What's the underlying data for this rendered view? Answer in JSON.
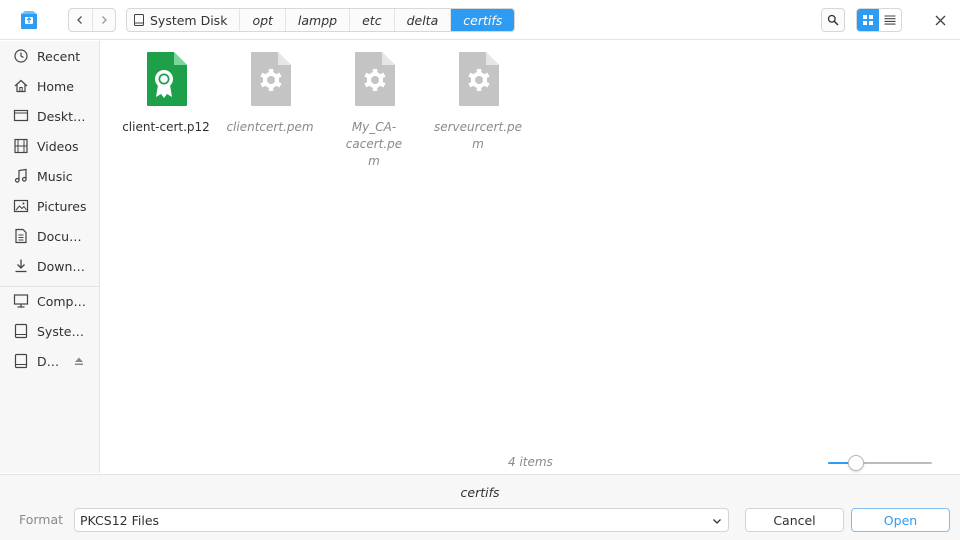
{
  "colors": {
    "accent": "#2d9cf2",
    "cert_green": "#1ea04a",
    "generic_file_gray": "#bdbdbd"
  },
  "titlebar": {
    "app_icon": "file-manager-icon",
    "back_icon": "chevron-left-icon",
    "forward_icon": "chevron-right-icon",
    "breadcrumbs": [
      {
        "label": "System Disk",
        "icon": "disk-icon"
      },
      {
        "label": "opt"
      },
      {
        "label": "lampp"
      },
      {
        "label": "etc"
      },
      {
        "label": "delta"
      },
      {
        "label": "certifs",
        "active": true
      }
    ],
    "search_icon": "search-icon",
    "view_icons": [
      "grid-view-icon",
      "list-view-icon"
    ],
    "active_view": "grid-view-icon",
    "close_icon": "close-icon"
  },
  "sidebar": {
    "items": [
      {
        "label": "Recent",
        "icon": "clock-icon"
      },
      {
        "label": "Home",
        "icon": "home-icon"
      },
      {
        "label": "Desktop",
        "icon": "desktop-icon"
      },
      {
        "label": "Videos",
        "icon": "film-icon"
      },
      {
        "label": "Music",
        "icon": "music-note-icon"
      },
      {
        "label": "Pictures",
        "icon": "image-icon"
      },
      {
        "label": "Documents",
        "icon": "document-icon"
      },
      {
        "label": "Downloads",
        "icon": "download-icon"
      },
      {
        "label": "Computer",
        "icon": "monitor-icon"
      },
      {
        "label": "System Disk",
        "icon": "disk-icon"
      },
      {
        "label": "Data Disk",
        "icon": "disk-icon",
        "eject_icon": "eject-icon"
      }
    ]
  },
  "files": [
    {
      "name": "client-cert.p12",
      "icon": "certificate-file-icon",
      "selectable": true
    },
    {
      "name": "clientcert.pem",
      "icon": "settings-file-icon",
      "selectable": false
    },
    {
      "name": "My_CA-cacert.pem",
      "icon": "settings-file-icon",
      "selectable": false
    },
    {
      "name": "serveurcert.pem",
      "icon": "settings-file-icon",
      "selectable": false
    }
  ],
  "status": {
    "item_count": "4 items",
    "zoom_level": 0.27
  },
  "footer": {
    "folder_name": "certifs",
    "format_label": "Format",
    "format_value": "PKCS12 Files",
    "cancel_label": "Cancel",
    "open_label": "Open"
  }
}
